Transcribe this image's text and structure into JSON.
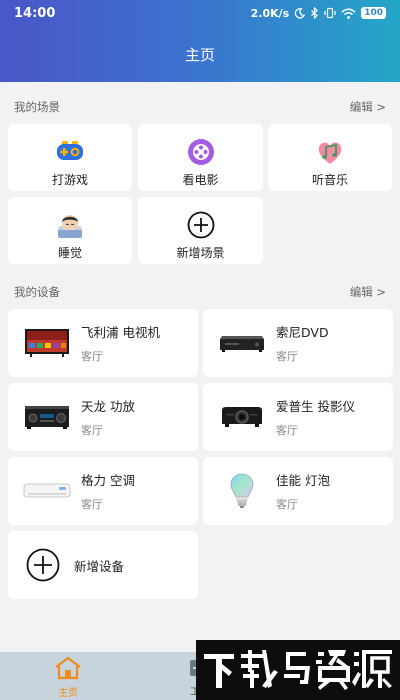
{
  "status_bar": {
    "time": "14:00",
    "net_speed": "2.0K/s",
    "battery": "100",
    "icons": [
      "moon-icon",
      "bluetooth-icon",
      "wifi-icon",
      "battery-icon"
    ]
  },
  "header": {
    "title": "主页",
    "gradient": [
      "#4a56c7",
      "#23a7c8"
    ]
  },
  "scenes": {
    "title": "我的场景",
    "edit": "编辑 >",
    "items": [
      {
        "label": "打游戏",
        "icon": "gamepad-icon"
      },
      {
        "label": "看电影",
        "icon": "movie-icon"
      },
      {
        "label": "听音乐",
        "icon": "music-icon"
      },
      {
        "label": "睡觉",
        "icon": "sleep-icon"
      },
      {
        "label": "新增场景",
        "icon": "plus-circle-icon"
      }
    ]
  },
  "devices": {
    "title": "我的设备",
    "edit": "编辑 >",
    "items": [
      {
        "name": "飞利浦 电视机",
        "room": "客厅",
        "icon": "tv-icon"
      },
      {
        "name": "索尼DVD",
        "room": "客厅",
        "icon": "dvd-player-icon"
      },
      {
        "name": "天龙 功放",
        "room": "客厅",
        "icon": "amplifier-icon"
      },
      {
        "name": "爱普生 投影仪",
        "room": "客厅",
        "icon": "projector-icon"
      },
      {
        "name": "格力 空调",
        "room": "客厅",
        "icon": "air-conditioner-icon"
      },
      {
        "name": "佳能 灯泡",
        "room": "客厅",
        "icon": "light-bulb-icon"
      }
    ],
    "add_label": "新增设备"
  },
  "tabbar": {
    "home_label": "主页",
    "tools_label": "工",
    "active_color": "#f08a1c"
  },
  "watermark": {
    "text": "下载鸟资源"
  }
}
